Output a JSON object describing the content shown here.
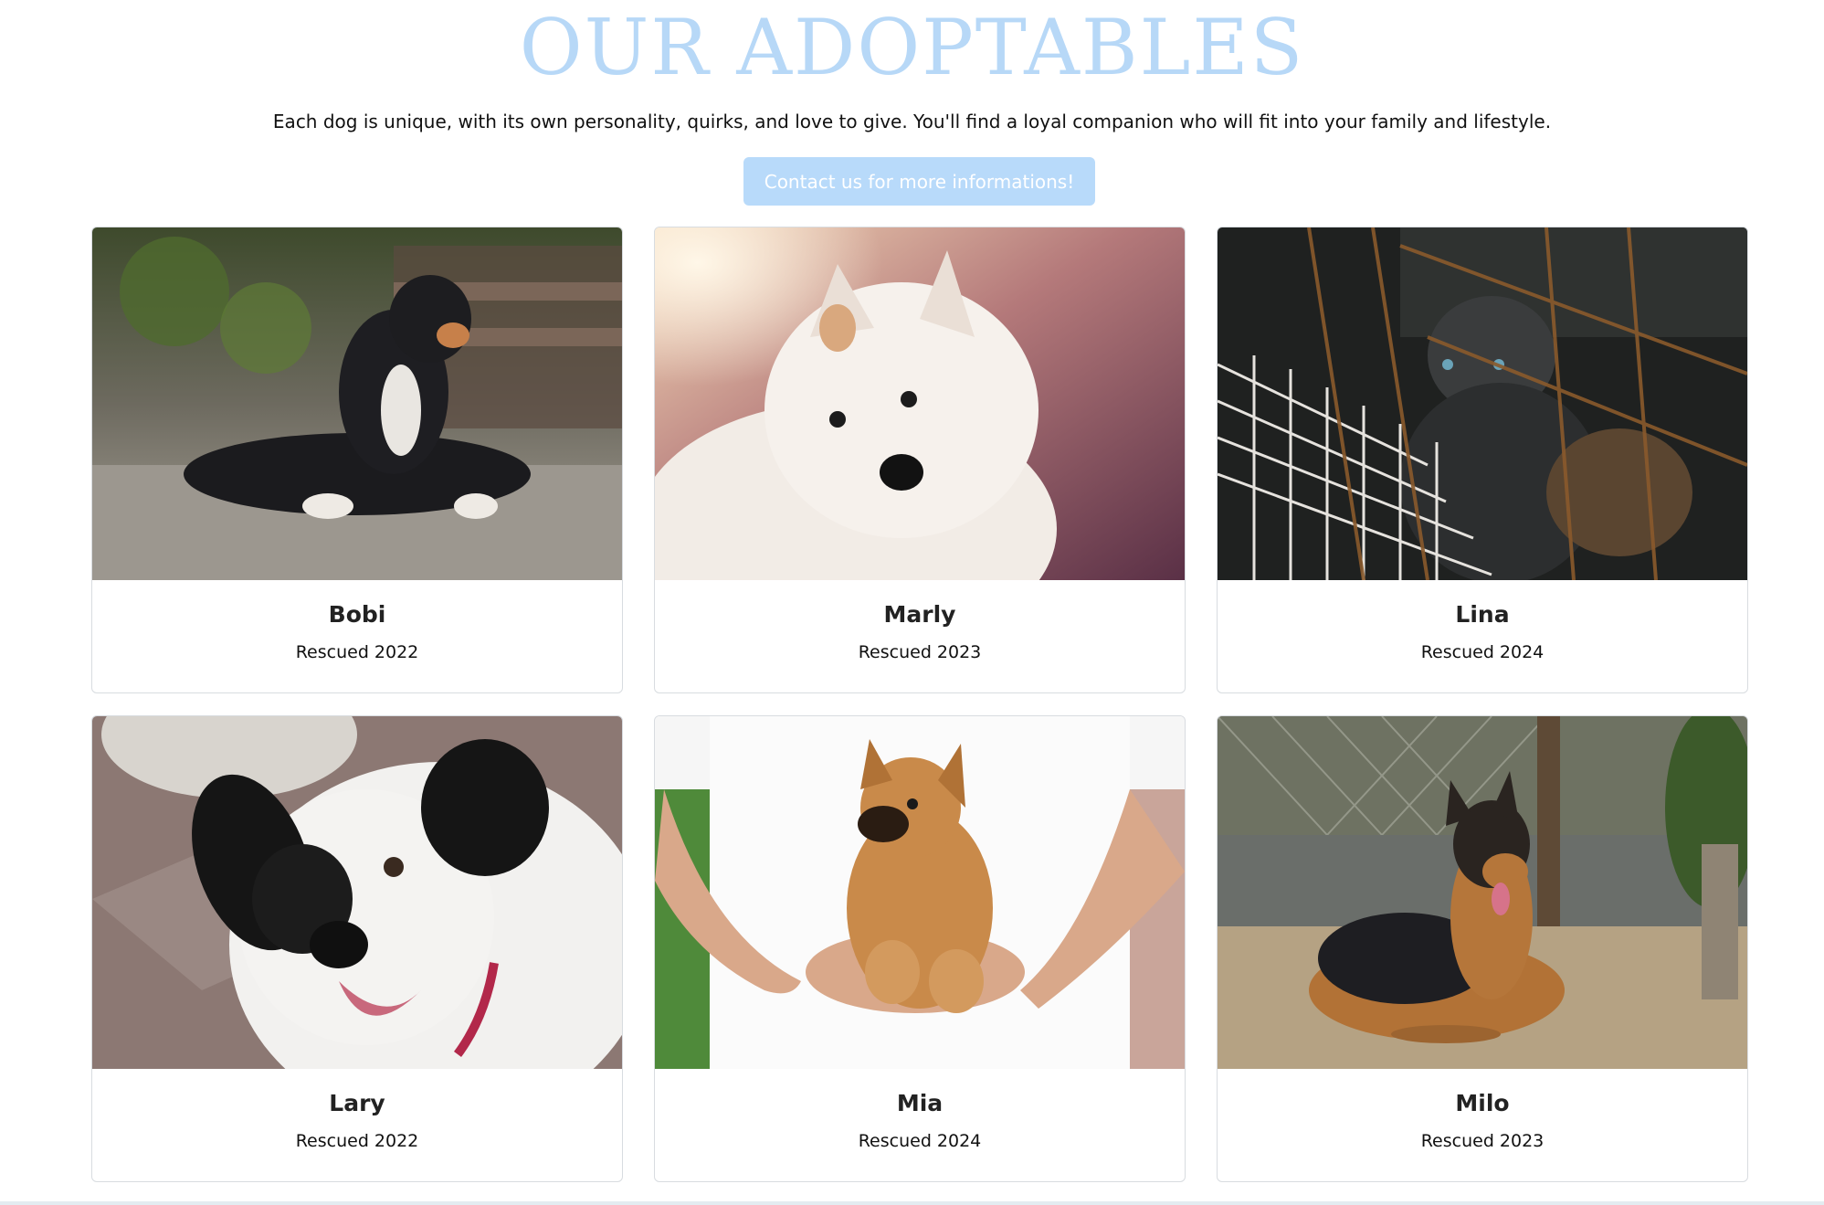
{
  "header": {
    "title": "OUR ADOPTABLES",
    "subtitle": "Each dog is unique, with its own personality, quirks, and love to give. You'll find a loyal companion who will fit into your family and lifestyle.",
    "cta_label": "Contact us for more informations!"
  },
  "colors": {
    "accent": "#b8dafa",
    "title": "#b7d8f7"
  },
  "dogs": [
    {
      "name": "Bobi",
      "rescued": "Rescued 2022"
    },
    {
      "name": "Marly",
      "rescued": "Rescued 2023"
    },
    {
      "name": "Lina",
      "rescued": "Rescued 2024"
    },
    {
      "name": "Lary",
      "rescued": "Rescued 2022"
    },
    {
      "name": "Mia",
      "rescued": "Rescued 2024"
    },
    {
      "name": "Milo",
      "rescued": "Rescued 2023"
    }
  ]
}
